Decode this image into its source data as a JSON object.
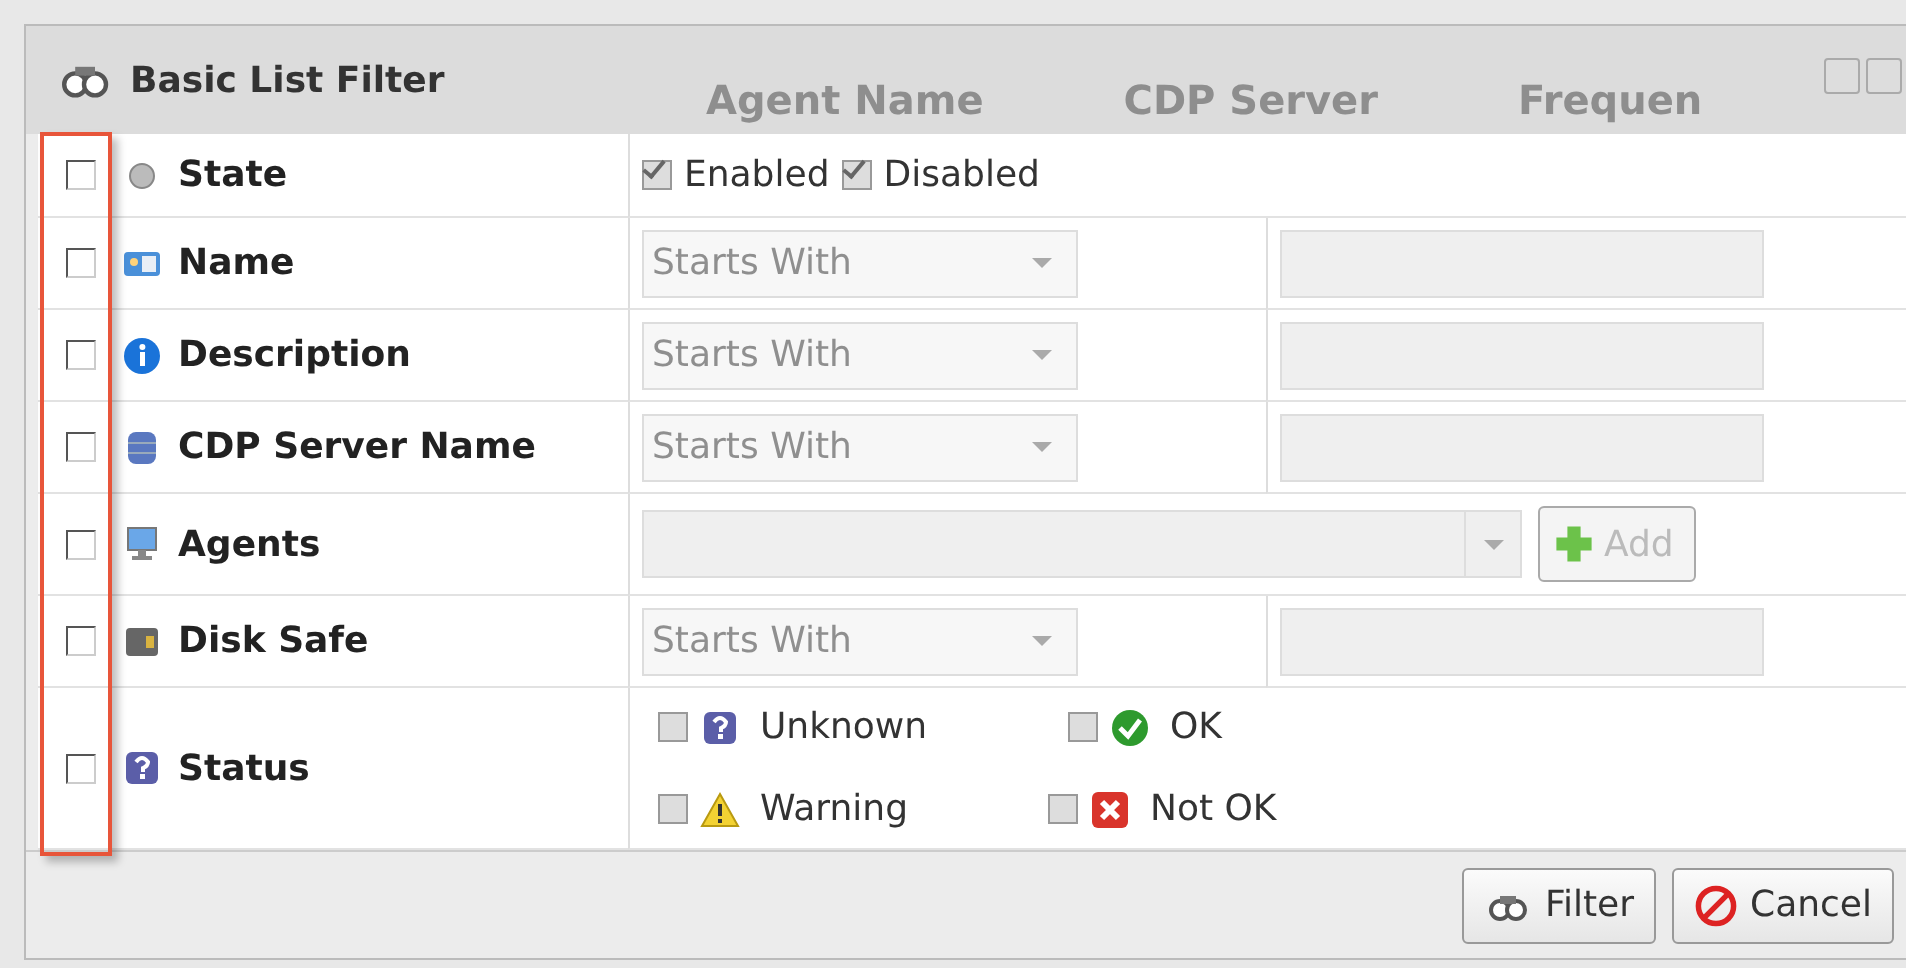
{
  "background_columns": [
    "Agent Name",
    "CDP Server",
    "Frequen"
  ],
  "window": {
    "title": "Basic List Filter"
  },
  "rows": [
    {
      "kind": "state",
      "label": "State",
      "checked": false,
      "options": [
        {
          "label": "Enabled",
          "checked": true
        },
        {
          "label": "Disabled",
          "checked": true
        }
      ]
    },
    {
      "kind": "text",
      "label": "Name",
      "checked": false,
      "operator": "Starts With"
    },
    {
      "kind": "text",
      "label": "Description",
      "checked": false,
      "operator": "Starts With"
    },
    {
      "kind": "text",
      "label": "CDP Server Name",
      "checked": false,
      "operator": "Starts With"
    },
    {
      "kind": "agents",
      "label": "Agents",
      "checked": false,
      "button": "Add"
    },
    {
      "kind": "text",
      "label": "Disk Safe",
      "checked": false,
      "operator": "Starts With"
    },
    {
      "kind": "status",
      "label": "Status",
      "checked": false,
      "options": [
        {
          "label": "Unknown",
          "checked": false
        },
        {
          "label": "OK",
          "checked": false
        },
        {
          "label": "Warning",
          "checked": false
        },
        {
          "label": "Not OK",
          "checked": false
        }
      ]
    }
  ],
  "buttons": [
    "Filter",
    "Cancel"
  ]
}
